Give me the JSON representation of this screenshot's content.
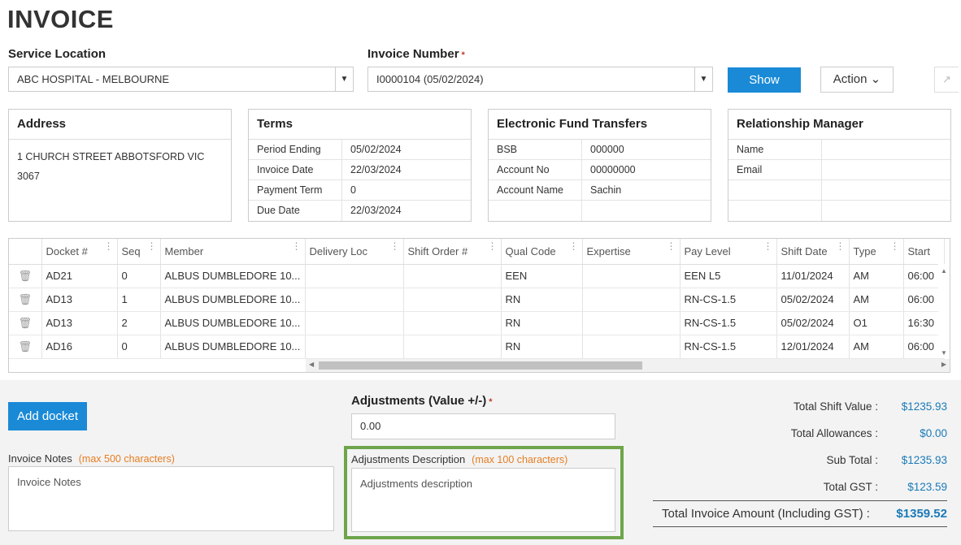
{
  "page": {
    "title": "INVOICE"
  },
  "service_location": {
    "label": "Service Location",
    "value": "ABC HOSPITAL - MELBOURNE"
  },
  "invoice_number": {
    "label": "Invoice Number",
    "required_mark": "*",
    "value": "I0000104 (05/02/2024)"
  },
  "toolbar": {
    "show_label": "Show",
    "action_label": "Action ⌄",
    "expand_icon": "↗"
  },
  "address": {
    "title": "Address",
    "line1": "1 CHURCH STREET ABBOTSFORD VIC",
    "line2": "3067"
  },
  "terms": {
    "title": "Terms",
    "rows": [
      {
        "k": "Period Ending",
        "v": "05/02/2024"
      },
      {
        "k": "Invoice Date",
        "v": "22/03/2024"
      },
      {
        "k": "Payment Term",
        "v": "0"
      },
      {
        "k": "Due Date",
        "v": "22/03/2024"
      }
    ]
  },
  "eft": {
    "title": "Electronic Fund Transfers",
    "rows": [
      {
        "k": "BSB",
        "v": "000000"
      },
      {
        "k": "Account No",
        "v": "00000000"
      },
      {
        "k": "Account Name",
        "v": "Sachin"
      },
      {
        "k": "",
        "v": ""
      }
    ]
  },
  "manager": {
    "title": "Relationship Manager",
    "rows": [
      {
        "k": "Name",
        "v": ""
      },
      {
        "k": "Email",
        "v": ""
      },
      {
        "k": "",
        "v": ""
      },
      {
        "k": "",
        "v": ""
      }
    ]
  },
  "grid": {
    "columns": [
      "",
      "Docket #",
      "Seq",
      "Member",
      "Delivery Loc",
      "Shift Order #",
      "Qual Code",
      "Expertise",
      "Pay Level",
      "Shift Date",
      "Type",
      "Start"
    ],
    "rows": [
      [
        "AD21",
        "0",
        "ALBUS DUMBLEDORE 10...",
        "",
        "",
        "EEN",
        "",
        "EEN L5",
        "11/01/2024",
        "AM",
        "06:00"
      ],
      [
        "AD13",
        "1",
        "ALBUS DUMBLEDORE 10...",
        "",
        "",
        "RN",
        "",
        "RN-CS-1.5",
        "05/02/2024",
        "AM",
        "06:00"
      ],
      [
        "AD13",
        "2",
        "ALBUS DUMBLEDORE 10...",
        "",
        "",
        "RN",
        "",
        "RN-CS-1.5",
        "05/02/2024",
        "O1",
        "16:30"
      ],
      [
        "AD16",
        "0",
        "ALBUS DUMBLEDORE 10...",
        "",
        "",
        "RN",
        "",
        "RN-CS-1.5",
        "12/01/2024",
        "AM",
        "06:00"
      ]
    ]
  },
  "footer": {
    "add_docket_label": "Add docket",
    "adjustments_label": "Adjustments (Value +/-)",
    "adjustments_value": "0.00",
    "invoice_notes_label": "Invoice Notes",
    "invoice_notes_hint": "(max 500 characters)",
    "invoice_notes_placeholder": "Invoice Notes",
    "adj_desc_label": "Adjustments Description",
    "adj_desc_hint": "(max 100 characters)",
    "adj_desc_placeholder": "Adjustments description"
  },
  "totals": {
    "shift_value_label": "Total Shift Value :",
    "shift_value": "$1235.93",
    "allowances_label": "Total Allowances :",
    "allowances": "$0.00",
    "sub_total_label": "Sub Total :",
    "sub_total": "$1235.93",
    "gst_label": "Total GST :",
    "gst": "$123.59",
    "grand_label": "Total Invoice Amount (Including GST) :",
    "grand": "$1359.52"
  },
  "colors": {
    "primary": "#1a8ad6",
    "highlight": "#6ea54a",
    "hint": "#e67e22",
    "total_value": "#1a7ab8"
  }
}
